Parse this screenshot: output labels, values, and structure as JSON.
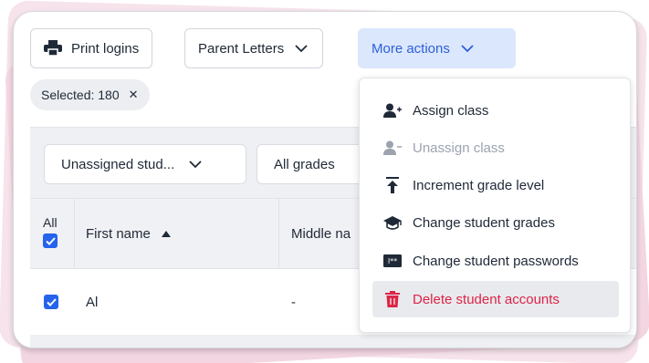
{
  "toolbar": {
    "print_logins": "Print logins",
    "parent_letters": "Parent Letters",
    "more_actions": "More actions"
  },
  "selection": {
    "label": "Selected: 180",
    "close_glyph": "✕"
  },
  "filters": {
    "student_filter": "Unassigned stud...",
    "grade_filter": "All grades"
  },
  "table": {
    "select_all_label": "All",
    "columns": {
      "first_name": "First name",
      "middle_name": "Middle na"
    },
    "rows": [
      {
        "first_name": "Al",
        "middle_name": "-"
      }
    ]
  },
  "menu": {
    "items": [
      {
        "label": "Assign class",
        "icon": "user-plus-icon",
        "state": "enabled"
      },
      {
        "label": "Unassign class",
        "icon": "user-minus-icon",
        "state": "disabled"
      },
      {
        "label": "Increment grade level",
        "icon": "arrow-up-to-line-icon",
        "state": "enabled"
      },
      {
        "label": "Change student grades",
        "icon": "graduation-cap-icon",
        "state": "enabled"
      },
      {
        "label": "Change student passwords",
        "icon": "password-icon",
        "state": "enabled"
      },
      {
        "label": "Delete student accounts",
        "icon": "trash-icon",
        "state": "hovered"
      }
    ]
  },
  "colors": {
    "accent": "#2563eb",
    "primary_button_bg": "#dbe7fd",
    "danger": "#dc2447",
    "backdrop": "#f3d6e2"
  }
}
